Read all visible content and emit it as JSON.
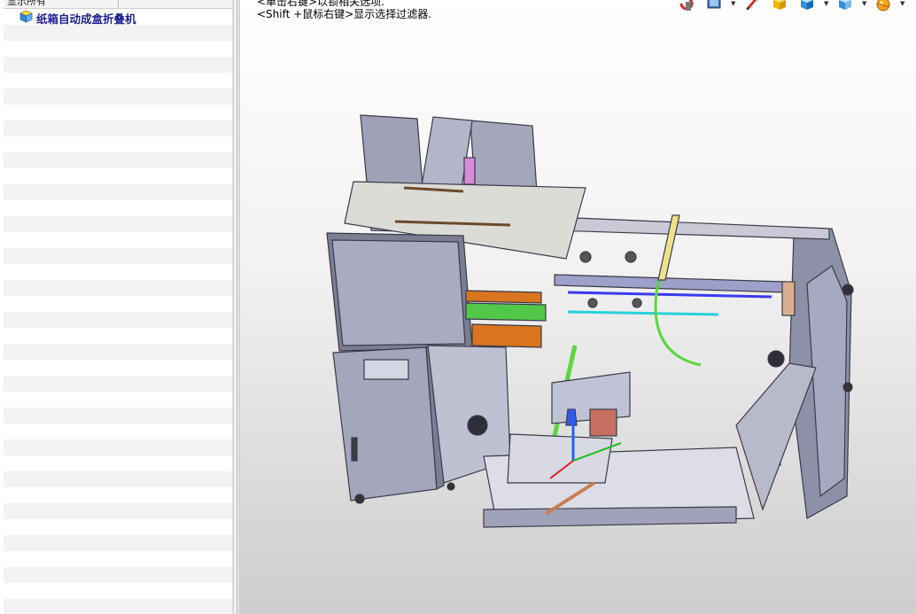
{
  "tree": {
    "header_col1": "显示所有",
    "header_col2": "",
    "root_item": {
      "label": "纸箱自动成盒折叠机",
      "icon": "assembly-icon"
    }
  },
  "viewport": {
    "hint_line1": "<单击右键>以锁相关选项.",
    "hint_line2": "<Shift +鼠标右键>显示选择过滤器."
  },
  "toolbar": {
    "buttons": [
      {
        "name": "rotate-view-icon",
        "color": "#d62e2e"
      },
      {
        "name": "view-orientation-icon",
        "color": "#3d6fb6"
      },
      {
        "name": "edit-pencil-icon",
        "color": "#c8382f"
      },
      {
        "name": "shaded-cube-icon",
        "color": "#f0b400"
      },
      {
        "name": "display-style-icon",
        "color": "#2f8fd8"
      },
      {
        "name": "section-view-icon",
        "color": "#2f8fd8"
      },
      {
        "name": "appearance-icon",
        "color": "#f6a21a"
      }
    ]
  }
}
